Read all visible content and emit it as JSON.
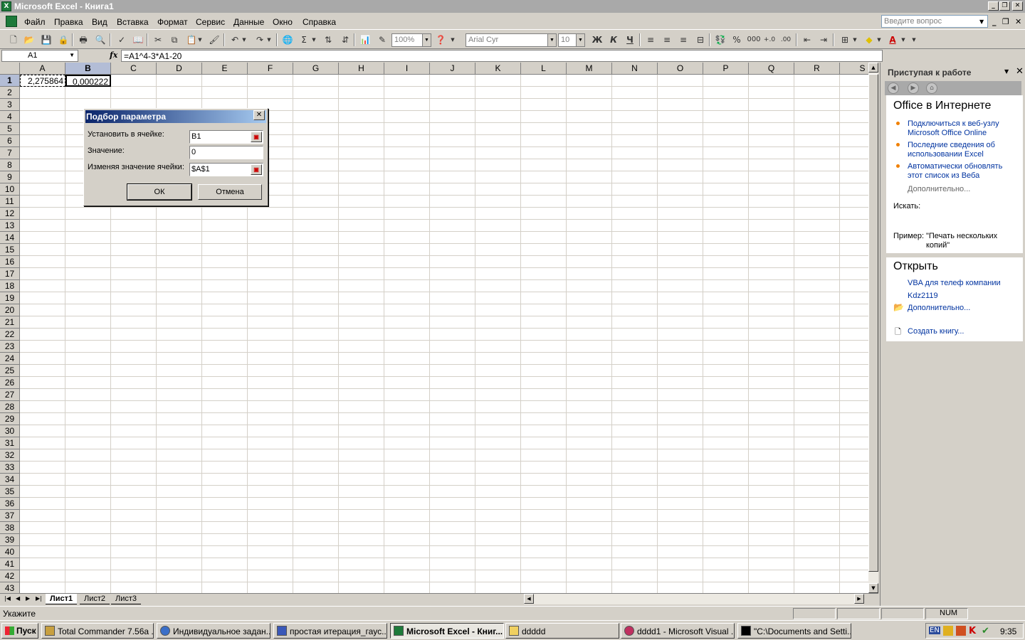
{
  "window": {
    "title": "Microsoft Excel - Книга1"
  },
  "menu": {
    "items": [
      "Файл",
      "Правка",
      "Вид",
      "Вставка",
      "Формат",
      "Сервис",
      "Данные",
      "Окно",
      "Справка"
    ],
    "ask_placeholder": "Введите вопрос"
  },
  "toolbar": {
    "zoom": "100%",
    "font": "Arial Cyr",
    "size": "10",
    "bold": "Ж",
    "italic": "К",
    "underline": "Ч",
    "percent": "%",
    "thousands": "000",
    "sum": "Σ"
  },
  "formula_bar": {
    "name_box": "A1",
    "fx": "fx",
    "formula": "=A1^4-3*A1-20"
  },
  "grid": {
    "columns": [
      "A",
      "B",
      "C",
      "D",
      "E",
      "F",
      "G",
      "H",
      "I",
      "J",
      "K",
      "L",
      "M",
      "N",
      "O",
      "P",
      "Q",
      "R",
      "S"
    ],
    "rows": [
      "1",
      "2",
      "3",
      "4",
      "5",
      "6",
      "7",
      "8",
      "9",
      "10",
      "11",
      "12",
      "13",
      "14",
      "15",
      "16",
      "17",
      "18",
      "19",
      "20",
      "21",
      "22",
      "23",
      "24",
      "25",
      "26",
      "27",
      "28",
      "29",
      "30",
      "31",
      "32",
      "33",
      "34",
      "35",
      "36",
      "37",
      "38",
      "39",
      "40",
      "41",
      "42",
      "43"
    ],
    "cells": {
      "A1": "2,275864",
      "B1": "0,000222"
    }
  },
  "sheets": [
    "Лист1",
    "Лист2",
    "Лист3"
  ],
  "status": {
    "mode": "Укажите",
    "num": "NUM"
  },
  "dialog": {
    "title": "Подбор параметра",
    "set_cell_label": "Установить в ячейке:",
    "set_cell_value": "B1",
    "value_label": "Значение:",
    "value_value": "0",
    "changing_label": "Изменяя значение ячейки:",
    "changing_value": "$A$1",
    "ok": "ОК",
    "cancel": "Отмена"
  },
  "task_pane": {
    "title": "Приступая к работе",
    "office_heading": "Office в Интернете",
    "links": [
      "Подключиться к веб-узлу Microsoft Office Online",
      "Последние сведения об использовании Excel",
      "Автоматически обновлять этот список из Веба"
    ],
    "more": "Дополнительно...",
    "search_label": "Искать:",
    "example_prefix": "Пример:",
    "example_text": "\"Печать нескольких копий\"",
    "open_heading": "Открыть",
    "recent": [
      "VBA для телеф компании",
      "Kdz2119"
    ],
    "open_more": "Дополнительно...",
    "create": "Создать книгу..."
  },
  "taskbar": {
    "start": "Пуск",
    "tasks": [
      "Total Commander 7.56a ...",
      "Индивидуальное задан...",
      "простая итерация_гаус...",
      "Microsoft Excel - Книг...",
      "ddddd",
      "dddd1 - Microsoft Visual ...",
      "\"C:\\Documents and Setti..."
    ],
    "lang": "EN",
    "clock": "9:35"
  },
  "colors": {
    "selection_header": "#b3bdd6",
    "dialog_title_start": "#0a246a",
    "link": "#0033a0",
    "bullet": "#f08000"
  }
}
